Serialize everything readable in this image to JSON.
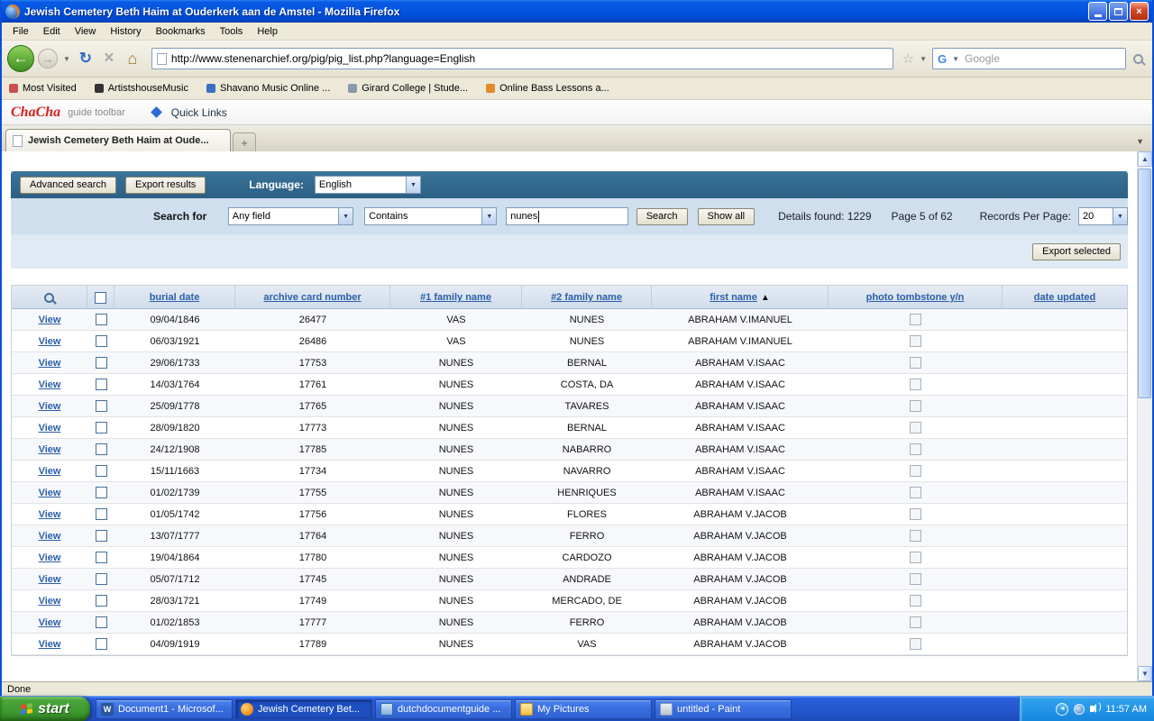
{
  "icons": {
    "back": "←",
    "forward": "→",
    "reload": "↻",
    "stop": "×",
    "home": "⌂",
    "star": "☆",
    "dropdown": "▼",
    "small_dropdown": "▼",
    "sort_asc": "▲",
    "scroll_up": "▲",
    "scroll_down": "▼",
    "new_tab": "+",
    "tray_chevron": "◄",
    "close": "×",
    "google_g": "G"
  },
  "colors": {
    "accent_blue": "#2b5fa8",
    "header_bar": "#2c5f84",
    "xp_blue": "#2456cc",
    "start_green": "#3d9a2e"
  },
  "window": {
    "title": "Jewish Cemetery Beth Haim at Ouderkerk aan de Amstel - Mozilla Firefox"
  },
  "menubar": {
    "items": [
      "File",
      "Edit",
      "View",
      "History",
      "Bookmarks",
      "Tools",
      "Help"
    ]
  },
  "navbar": {
    "url": "http://www.stenenarchief.org/pig/pig_list.php?language=English",
    "search_value": "Google"
  },
  "bookmarks": {
    "items": [
      {
        "label": "Most Visited",
        "color": "#c94f4f"
      },
      {
        "label": "ArtistshouseMusic",
        "color": "#333333"
      },
      {
        "label": "Shavano Music Online ...",
        "color": "#3a6fc4"
      },
      {
        "label": "Girard College | Stude...",
        "color": "#8899aa"
      },
      {
        "label": "Online Bass Lessons a...",
        "color": "#e08a2a"
      }
    ]
  },
  "chacha": {
    "brand": "ChaCha",
    "tagline": "guide toolbar",
    "quick_links": "Quick Links"
  },
  "tabbar": {
    "tabs": [
      {
        "label": "Jewish Cemetery Beth Haim at Oude..."
      }
    ]
  },
  "page": {
    "toolbar": {
      "advanced_search": "Advanced search",
      "export_results": "Export results",
      "language_label": "Language:",
      "language_value": "English"
    },
    "search": {
      "label": "Search for",
      "field_value": "Any field",
      "operator_value": "Contains",
      "query": "nunes",
      "search_button": "Search",
      "show_all_button": "Show all",
      "details": "Details found: 1229",
      "page_info": "Page 5 of 62",
      "records_label": "Records Per Page:",
      "records_value": "20",
      "export_selected": "Export selected"
    },
    "table": {
      "headers": {
        "burial": "burial date",
        "card": "archive card number",
        "family1": "#1 family name",
        "family2": "#2 family name",
        "first": "first name",
        "photo": "photo tombstone y/n",
        "updated": "date updated"
      },
      "rows": [
        {
          "view": "View",
          "burial_date": "09/04/1846",
          "card_number": "26477",
          "family1": "VAS",
          "family2": "NUNES",
          "first_name": "ABRAHAM V.IMANUEL"
        },
        {
          "view": "View",
          "burial_date": "06/03/1921",
          "card_number": "26486",
          "family1": "VAS",
          "family2": "NUNES",
          "first_name": "ABRAHAM V.IMANUEL"
        },
        {
          "view": "View",
          "burial_date": "29/06/1733",
          "card_number": "17753",
          "family1": "NUNES",
          "family2": "BERNAL",
          "first_name": "ABRAHAM V.ISAAC"
        },
        {
          "view": "View",
          "burial_date": "14/03/1764",
          "card_number": "17761",
          "family1": "NUNES",
          "family2": "COSTA, DA",
          "first_name": "ABRAHAM V.ISAAC"
        },
        {
          "view": "View",
          "burial_date": "25/09/1778",
          "card_number": "17765",
          "family1": "NUNES",
          "family2": "TAVARES",
          "first_name": "ABRAHAM V.ISAAC"
        },
        {
          "view": "View",
          "burial_date": "28/09/1820",
          "card_number": "17773",
          "family1": "NUNES",
          "family2": "BERNAL",
          "first_name": "ABRAHAM V.ISAAC"
        },
        {
          "view": "View",
          "burial_date": "24/12/1908",
          "card_number": "17785",
          "family1": "NUNES",
          "family2": "NABARRO",
          "first_name": "ABRAHAM V.ISAAC"
        },
        {
          "view": "View",
          "burial_date": "15/11/1663",
          "card_number": "17734",
          "family1": "NUNES",
          "family2": "NAVARRO",
          "first_name": "ABRAHAM V.ISAAC"
        },
        {
          "view": "View",
          "burial_date": "01/02/1739",
          "card_number": "17755",
          "family1": "NUNES",
          "family2": "HENRIQUES",
          "first_name": "ABRAHAM V.ISAAC"
        },
        {
          "view": "View",
          "burial_date": "01/05/1742",
          "card_number": "17756",
          "family1": "NUNES",
          "family2": "FLORES",
          "first_name": "ABRAHAM V.JACOB"
        },
        {
          "view": "View",
          "burial_date": "13/07/1777",
          "card_number": "17764",
          "family1": "NUNES",
          "family2": "FERRO",
          "first_name": "ABRAHAM V.JACOB"
        },
        {
          "view": "View",
          "burial_date": "19/04/1864",
          "card_number": "17780",
          "family1": "NUNES",
          "family2": "CARDOZO",
          "first_name": "ABRAHAM V.JACOB"
        },
        {
          "view": "View",
          "burial_date": "05/07/1712",
          "card_number": "17745",
          "family1": "NUNES",
          "family2": "ANDRADE",
          "first_name": "ABRAHAM V.JACOB"
        },
        {
          "view": "View",
          "burial_date": "28/03/1721",
          "card_number": "17749",
          "family1": "NUNES",
          "family2": "MERCADO, DE",
          "first_name": "ABRAHAM V.JACOB"
        },
        {
          "view": "View",
          "burial_date": "01/02/1853",
          "card_number": "17777",
          "family1": "NUNES",
          "family2": "FERRO",
          "first_name": "ABRAHAM V.JACOB"
        },
        {
          "view": "View",
          "burial_date": "04/09/1919",
          "card_number": "17789",
          "family1": "NUNES",
          "family2": "VAS",
          "first_name": "ABRAHAM V.JACOB"
        }
      ]
    }
  },
  "statusbar": {
    "text": "Done"
  },
  "taskbar": {
    "start_label": "start",
    "items": [
      {
        "label": "Document1 - Microsof...",
        "icon": "word",
        "active": false
      },
      {
        "label": "Jewish Cemetery Bet...",
        "icon": "firefox",
        "active": true
      },
      {
        "label": "dutchdocumentguide ...",
        "icon": "window",
        "active": false
      },
      {
        "label": "My Pictures",
        "icon": "folder",
        "active": false
      },
      {
        "label": "untitled - Paint",
        "icon": "paint",
        "active": false
      }
    ],
    "clock": "11:57 AM"
  }
}
